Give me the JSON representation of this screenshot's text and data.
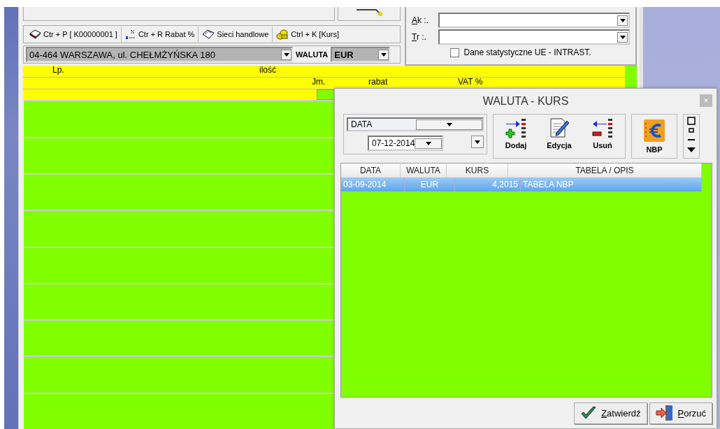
{
  "toolbar": [
    {
      "label": "Ctr + P [ K00000001 ]",
      "kind": "print"
    },
    {
      "label": "Ctr + R Rabat %",
      "kind": "discount"
    },
    {
      "label": "Sieci handlowe",
      "kind": "network"
    },
    {
      "label": "Ctrl + K [Kurs]",
      "kind": "coins"
    }
  ],
  "address_select": {
    "value": "04-464 WARSZAWA, ul. CHEŁMŻYŃSKA 180"
  },
  "currency": {
    "label": "WALUTA",
    "value": "EUR"
  },
  "side_fields": [
    {
      "label": "Ak :."
    },
    {
      "label": "Tr :."
    }
  ],
  "intrastat": {
    "label": "Dane statystyczne UE - INTRAST.",
    "checked": false
  },
  "grid_header": {
    "row1": [
      "Lp.",
      "ilość"
    ],
    "row2": [
      "Jm.",
      "rabat",
      "VAT %"
    ]
  },
  "dialog": {
    "title": "WALUTA - KURS",
    "close": "×",
    "filter_field": "DATA",
    "date": "07-12-2014",
    "actions": [
      {
        "label": "Dodaj",
        "kind": "add"
      },
      {
        "label": "Edycja",
        "kind": "edit"
      },
      {
        "label": "Usuń",
        "kind": "remove"
      }
    ],
    "nbp": {
      "label": "NBP"
    },
    "columns": [
      "DATA",
      "WALUTA",
      "KURS",
      "TABELA / OPIS"
    ],
    "rows": [
      {
        "cells": [
          "03-09-2014",
          "EUR",
          "4,2015",
          "TABELA NBP"
        ],
        "selected": true
      }
    ],
    "buttons": [
      {
        "label": "Zatwierdź",
        "kind": "confirm"
      },
      {
        "label": "Porzuć",
        "kind": "cancel"
      }
    ]
  }
}
